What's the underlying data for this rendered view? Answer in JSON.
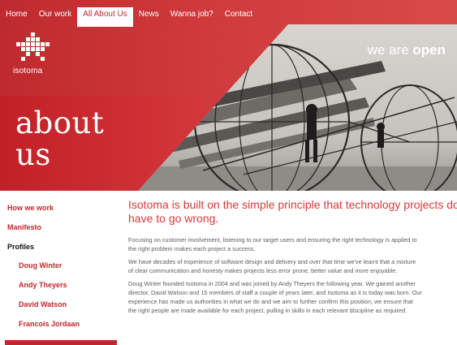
{
  "nav": {
    "items": [
      {
        "label": "Home"
      },
      {
        "label": "Our work"
      },
      {
        "label": "All About Us"
      },
      {
        "label": "News"
      },
      {
        "label": "Wanna job?"
      },
      {
        "label": "Contact"
      }
    ],
    "active_index": 2
  },
  "logo": {
    "text": "isotoma"
  },
  "hero": {
    "tagline_normal": "we are ",
    "tagline_bold": "open",
    "title_line1": "about",
    "title_line2": "us"
  },
  "sidebar": {
    "items": [
      {
        "label": "How we work"
      },
      {
        "label": "Manifesto"
      },
      {
        "label": "Profiles"
      },
      {
        "label": "Doug Winter"
      },
      {
        "label": "Andy Theyers"
      },
      {
        "label": "David Watson"
      },
      {
        "label": "Francois Jordaan"
      }
    ]
  },
  "content": {
    "headline_line1": "Isotoma is built on the simple principle that technology projects do not",
    "headline_line2": "have to go wrong.",
    "p1_l1": "Focusing on customer involvement, listening to our target users and ensuring the right technology is applied to",
    "p1_l2": "the right problem makes each project a success.",
    "p2_l1": "We have decades of experience of software design and delivery and over that time we've learnt that a mixture",
    "p2_l2": "of clear communication and honesty makes projects less error prone, better value and more enjoyable.",
    "p3_l1": "Doug Winter founded Isotoma in 2004 and was joined by Andy Theyers the following year. We gained another",
    "p3_l2": "director, David Watson and 15 members of staff a couple of years later, and Isotoma as it is today was born. Our",
    "p3_l3": "experience has made us authorities in what we do and we aim to further confirm this position; we ensure that",
    "p3_l4": "the right people are made available for each project, pulling in skills in each relevant discipline as required."
  },
  "colors": {
    "brand_red": "#c3262c",
    "headline_red": "#d63a3a"
  }
}
